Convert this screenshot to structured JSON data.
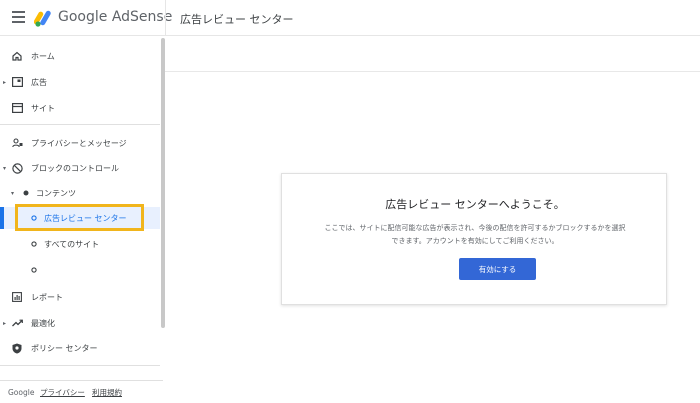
{
  "header": {
    "brand": "Google AdSense",
    "title": "広告レビュー センター"
  },
  "sidebar": {
    "items": [
      {
        "label": "ホーム",
        "icon": "home-icon"
      },
      {
        "label": "広告",
        "icon": "ads-icon"
      },
      {
        "label": "サイト",
        "icon": "sites-icon"
      },
      {
        "label": "プライバシーとメッセージ",
        "icon": "privacy-icon"
      },
      {
        "label": "ブロックのコントロール",
        "icon": "block-icon"
      },
      {
        "label": "コンテンツ",
        "icon": "dot-icon"
      },
      {
        "label": "広告レビュー センター",
        "icon": "circle-icon"
      },
      {
        "label": "すべてのサイト",
        "icon": "circle-icon"
      },
      {
        "label": "",
        "icon": "circle-icon"
      },
      {
        "label": "レポート",
        "icon": "report-icon"
      },
      {
        "label": "最適化",
        "icon": "trending-icon"
      },
      {
        "label": "ポリシー センター",
        "icon": "policy-icon"
      }
    ]
  },
  "footer": {
    "google": "Google",
    "privacy": "プライバシー",
    "terms": "利用規約"
  },
  "card": {
    "title": "広告レビュー センターへようこそ。",
    "body": "ここでは、サイトに配信可能な広告が表示され、今後の配信を許可するかブロックするかを選択できます。アカウントを有効にしてご利用ください。",
    "button": "有効にする"
  },
  "colors": {
    "accent": "#1a73e8",
    "button": "#3367d6",
    "highlight": "#f1b51c"
  }
}
